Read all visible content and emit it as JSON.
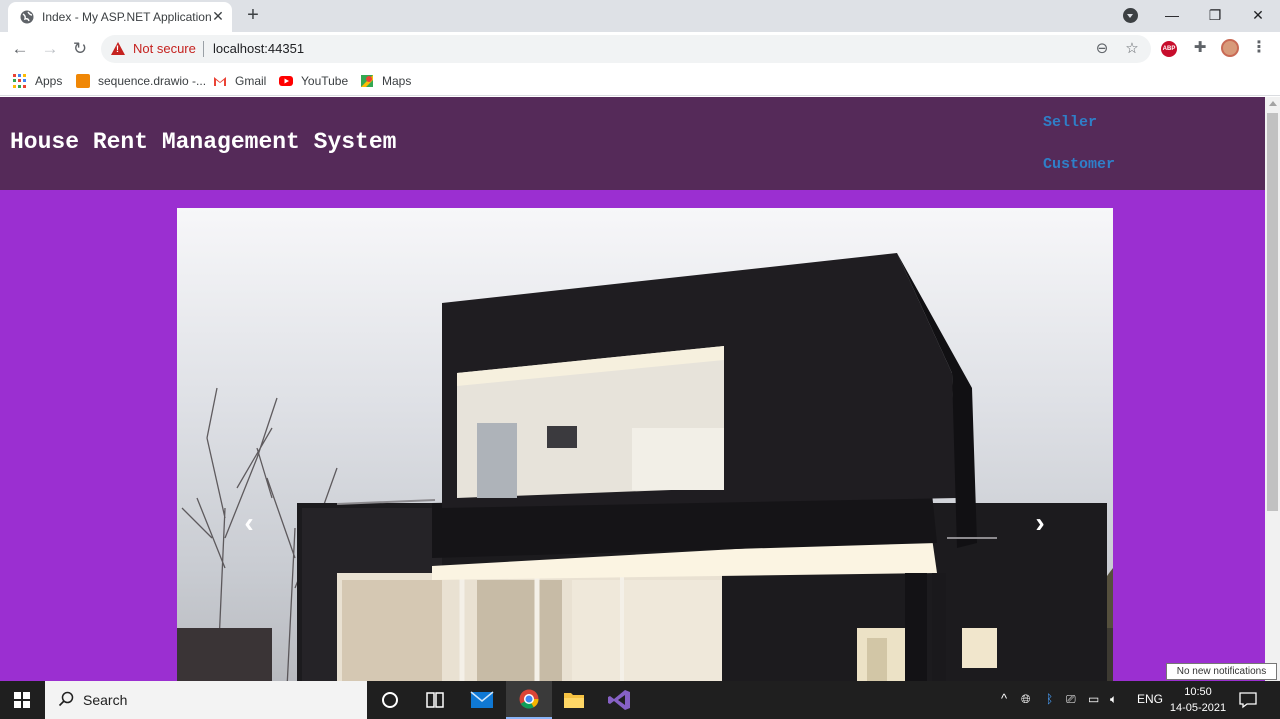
{
  "browser": {
    "tab": {
      "title": "Index - My ASP.NET Application",
      "favicon": "globe-icon",
      "close": "✕"
    },
    "new_tab": "+",
    "window_controls": {
      "minimize": "—",
      "restore": "❐",
      "close": "✕"
    },
    "address": {
      "security_label": "Not secure",
      "url": "localhost:44351"
    },
    "bookmarks": [
      {
        "label": "Apps",
        "icon": "apps-grid-icon"
      },
      {
        "label": "sequence.drawio -...",
        "icon": "drawio-icon"
      },
      {
        "label": "Gmail",
        "icon": "gmail-icon"
      },
      {
        "label": "YouTube",
        "icon": "youtube-icon"
      },
      {
        "label": "Maps",
        "icon": "maps-icon"
      }
    ]
  },
  "site": {
    "title": "House Rent Management System",
    "nav": [
      {
        "label": "Seller"
      },
      {
        "label": "Customer"
      }
    ],
    "colors": {
      "header": "#552a59",
      "body": "#9b2fd1",
      "link": "#2f7fc8"
    },
    "carousel": {
      "prev": "‹",
      "next": "›",
      "image": "modern-house-photo"
    }
  },
  "taskbar": {
    "search_placeholder": "Search",
    "pinned": [
      "task-view-icon",
      "mail-icon",
      "chrome-icon",
      "file-explorer-icon",
      "visual-studio-icon"
    ],
    "tray": {
      "language": "ENG"
    },
    "clock": {
      "time": "10:50",
      "date": "14-05-2021"
    },
    "notification_tip": "No new notifications"
  }
}
